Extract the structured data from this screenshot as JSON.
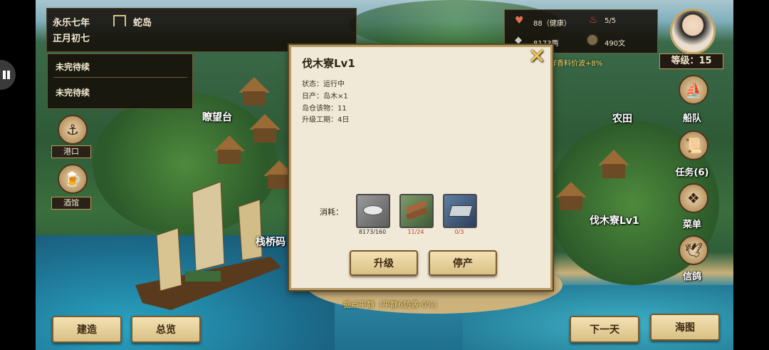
{
  "top_left": {
    "date": "永乐七年",
    "day": "正月初七",
    "location": "蛇岛"
  },
  "quests": [
    "未完待续",
    "未完待续"
  ],
  "stats": {
    "health": "88（健康）",
    "crew": "5/5",
    "silver": "8173两",
    "copper": "490文"
  },
  "level_label": "等级：15",
  "ticker": "洋香料价波+8%",
  "left_menu": [
    {
      "label": "港口",
      "icon": "anchor-icon"
    },
    {
      "label": "酒馆",
      "icon": "tankard-icon"
    }
  ],
  "right_menu": [
    {
      "label": "船队",
      "icon": "ship-icon"
    },
    {
      "label": "任务(6)",
      "icon": "scroll-icon"
    },
    {
      "label": "菜单",
      "icon": "fan-icon"
    },
    {
      "label": "信鸽",
      "icon": "pigeon-icon"
    }
  ],
  "map_labels": {
    "lookout": "瞭望台",
    "farm": "农田",
    "lumber": "伐木寮Lv1",
    "pier": "栈桥码"
  },
  "status_bar": "据点平静（平静6防袭-0%）",
  "bottom_buttons": {
    "build": "建造",
    "overview": "总览",
    "next_day": "下一天",
    "sea_map": "海图"
  },
  "dialog": {
    "title": "伐木寮Lv1",
    "lines": [
      "状态：运行中",
      "日产：岛木×1",
      "岛仓该物：11",
      "升级工期：4日"
    ],
    "cost_label": "消耗：",
    "costs": [
      {
        "name": "silver",
        "value": "8173/160",
        "color": "#2b2b2b"
      },
      {
        "name": "wood",
        "value": "11/24",
        "color": "#c0392b"
      },
      {
        "name": "iron",
        "value": "0/3",
        "color": "#c0392b"
      }
    ],
    "upgrade": "升级",
    "stop": "停产"
  },
  "colors": {
    "gold_border": "#b69a63",
    "panel_dark": "#140e08",
    "red_value": "#c0392b"
  }
}
